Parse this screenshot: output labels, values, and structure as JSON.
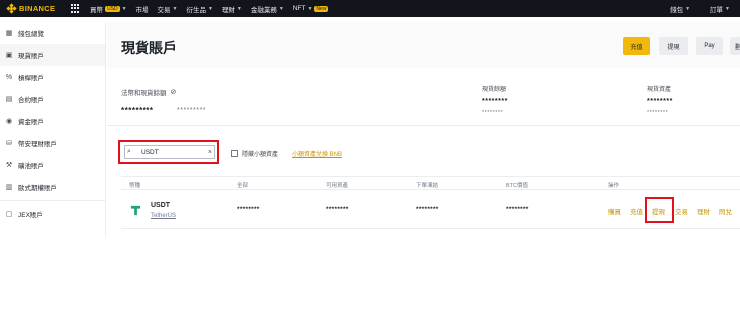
{
  "topbar": {
    "logo_text": "BINANCE",
    "nav": [
      {
        "label": "買幣",
        "badge": "USD"
      },
      {
        "label": "市場"
      },
      {
        "label": "交易"
      },
      {
        "label": "衍生品"
      },
      {
        "label": "理財"
      },
      {
        "label": "金融業務"
      },
      {
        "label": "NFT",
        "badge": "New"
      }
    ],
    "right": [
      "錢包",
      "訂單"
    ]
  },
  "sidebar": {
    "items": [
      {
        "label": "錢包總覽",
        "icon": "grid-icon"
      },
      {
        "label": "現貨賬戶",
        "icon": "wallet-icon",
        "active": true
      },
      {
        "label": "槓桿賬戶",
        "icon": "percent-icon"
      },
      {
        "label": "合約賬戶",
        "icon": "futures-icon"
      },
      {
        "label": "資金賬戶",
        "icon": "funding-icon"
      },
      {
        "label": "幣安理財賬戶",
        "icon": "earn-icon"
      },
      {
        "label": "礦池賬戶",
        "icon": "pickaxe-icon"
      },
      {
        "label": "歐式期權賬戶",
        "icon": "options-icon"
      },
      {
        "label": "JEX賬戶",
        "icon": "jex-icon"
      }
    ]
  },
  "header": {
    "title": "現貨賬戶",
    "buttons": [
      "充值",
      "提現",
      "Pay",
      "劃"
    ]
  },
  "balance": {
    "label": "法幣和現貨餘額",
    "value": "*********",
    "sub_value": "*********",
    "stats": [
      {
        "label": "現貨餘額",
        "value": "********",
        "sub": "********"
      },
      {
        "label": "現貨資產",
        "value": "********",
        "sub": "********"
      }
    ]
  },
  "search": {
    "value": "USDT",
    "hide_small_label": "隱藏小額資產",
    "convert_link": "小額資產兌換 BNB"
  },
  "table": {
    "headers": [
      "幣種",
      "全部",
      "可用資產",
      "下單凍結",
      "BTC價值",
      "操作"
    ],
    "rows": [
      {
        "symbol": "USDT",
        "name": "TetherUS",
        "total": "********",
        "available": "********",
        "in_order": "********",
        "btc_value": "********",
        "actions": [
          "購買",
          "充值",
          "提現",
          "交易",
          "理財",
          "閃兌"
        ]
      }
    ]
  },
  "colors": {
    "accent": "#f0b90b",
    "link": "#c99400",
    "highlight": "#e0111a",
    "topbar": "#12161c",
    "usdt": "#26a17b"
  }
}
